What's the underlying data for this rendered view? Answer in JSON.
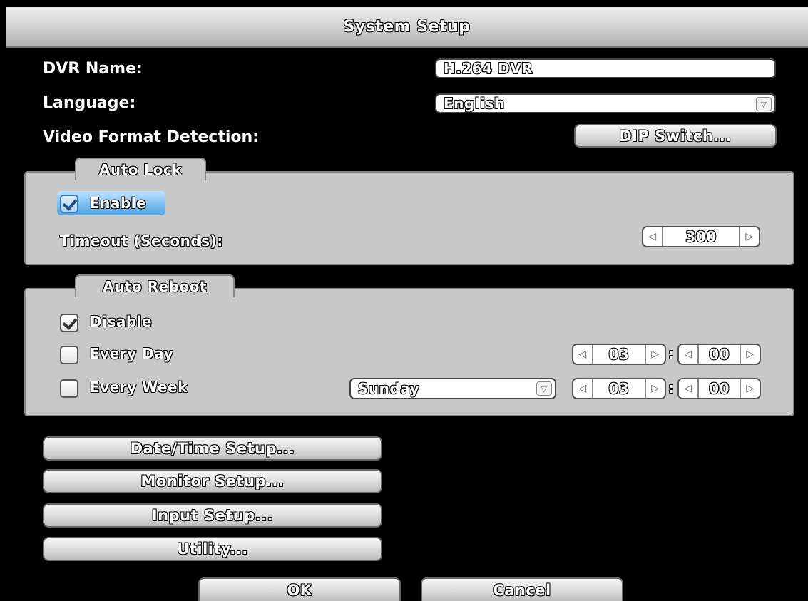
{
  "window": {
    "title": "System Setup"
  },
  "general": {
    "dvr_name_label": "DVR Name:",
    "dvr_name_value": "H.264 DVR",
    "language_label": "Language:",
    "language_value": "English",
    "video_format_label": "Video Format Detection:",
    "dip_switch_button": "DIP Switch..."
  },
  "auto_lock": {
    "tab": "Auto Lock",
    "enable_label": "Enable",
    "enable_checked": true,
    "timeout_label": "Timeout (Seconds):",
    "timeout_value": "300"
  },
  "auto_reboot": {
    "tab": "Auto Reboot",
    "disable_label": "Disable",
    "disable_checked": true,
    "every_day_label": "Every Day",
    "every_day_checked": false,
    "every_day_hour": "03",
    "every_day_minute": "00",
    "every_week_label": "Every Week",
    "every_week_checked": false,
    "weekday_value": "Sunday",
    "every_week_hour": "03",
    "every_week_minute": "00",
    "time_separator": ":"
  },
  "buttons": {
    "datetime": "Date/Time Setup...",
    "monitor": "Monitor Setup...",
    "input": "Input Setup...",
    "utility": "Utility...",
    "ok": "OK",
    "cancel": "Cancel"
  },
  "icons": {
    "left_arrow": "◁",
    "right_arrow": "▷",
    "dropdown": "▽"
  }
}
